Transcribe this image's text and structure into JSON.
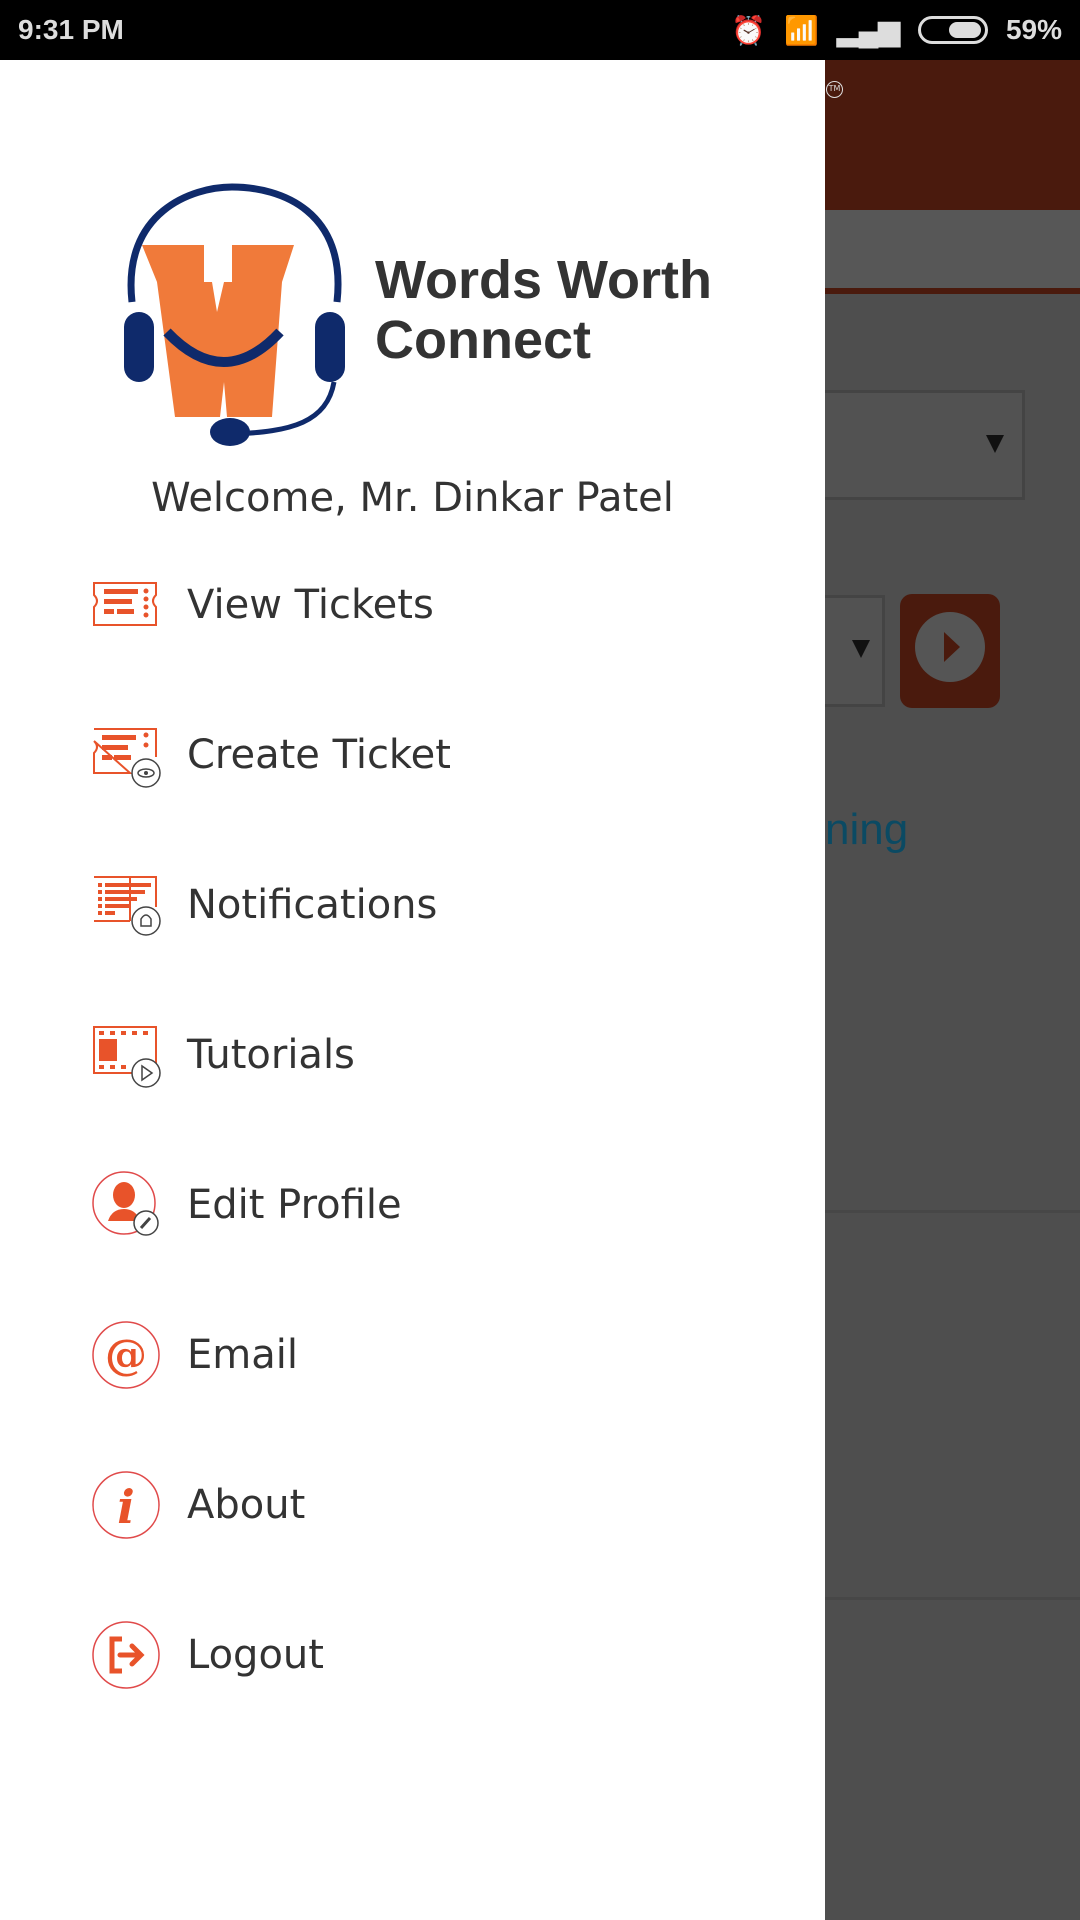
{
  "status": {
    "time": "9:31 PM",
    "battery": "59%"
  },
  "brand": {
    "line1": "Words Worth",
    "line2": "Connect",
    "color": "#f07a3a",
    "navy": "#0f2a6b"
  },
  "welcome": "Welcome, Mr. Dinkar Patel",
  "menu": [
    {
      "label": "View Tickets",
      "icon": "ticket-icon"
    },
    {
      "label": "Create Ticket",
      "icon": "ticket-eye-icon"
    },
    {
      "label": "Notifications",
      "icon": "list-bell-icon"
    },
    {
      "label": "Tutorials",
      "icon": "film-play-icon"
    },
    {
      "label": "Edit Profile",
      "icon": "user-edit-icon"
    },
    {
      "label": "Email",
      "icon": "at-icon"
    },
    {
      "label": "About",
      "icon": "info-icon"
    },
    {
      "label": "Logout",
      "icon": "logout-icon"
    }
  ],
  "background": {
    "partial_text": "ning",
    "accent": "#e8532a"
  }
}
